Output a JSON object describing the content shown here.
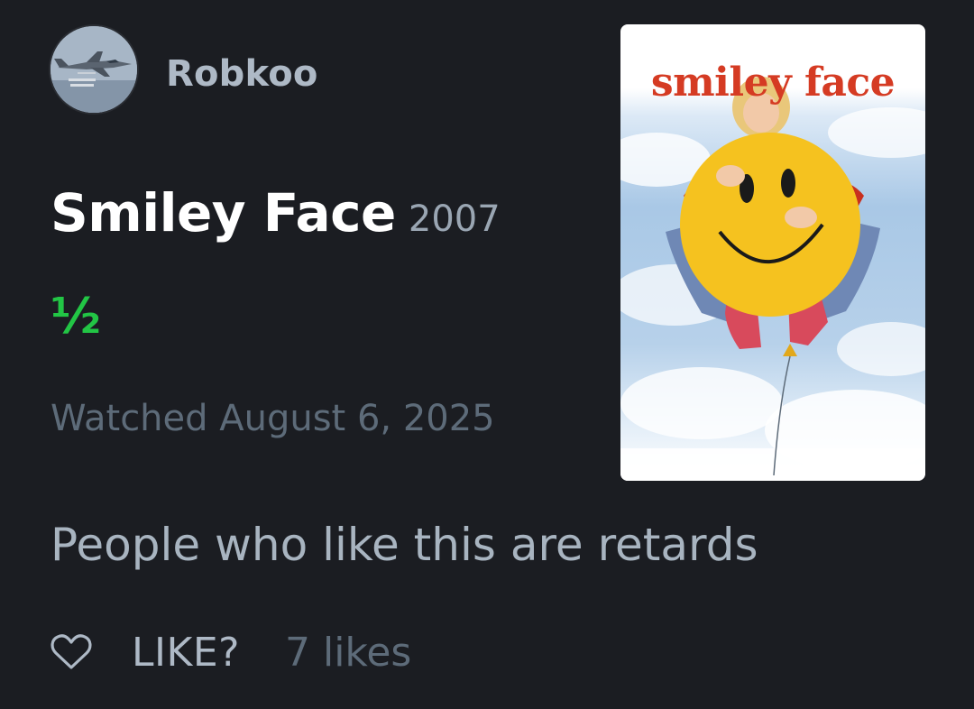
{
  "review": {
    "username": "Robkoo",
    "film_title": "Smiley Face",
    "film_year": "2007",
    "rating": "½",
    "watched": "Watched August 6, 2025",
    "text": "People who like this are retards"
  },
  "poster": {
    "title_text": "smiley face"
  },
  "actions": {
    "like_label": "LIKE?",
    "likes_count": "7 likes",
    "heart_icon": "heart-outline-icon"
  },
  "colors": {
    "background": "#1b1d22",
    "rating": "#22c545",
    "username": "#aeb9c6",
    "muted": "#5d6b79",
    "poster_title": "#d53b23"
  }
}
